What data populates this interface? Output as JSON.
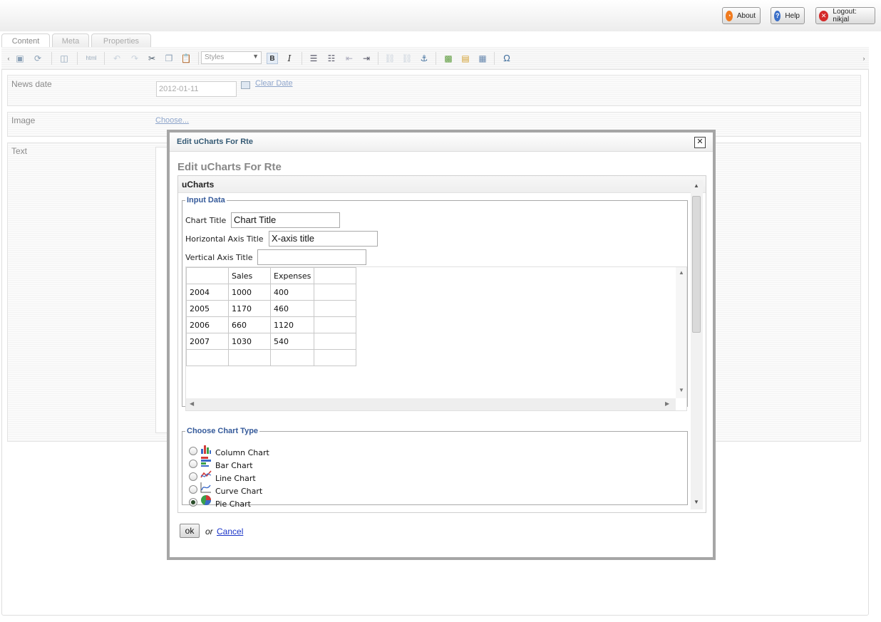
{
  "topbar": {
    "about_label": "About",
    "help_label": "Help",
    "logout_label": "Logout: nikjal"
  },
  "tabs": [
    {
      "label": "Content",
      "active": true
    },
    {
      "label": "Meta",
      "active": false
    },
    {
      "label": "Properties",
      "active": false
    }
  ],
  "toolbar": {
    "styles_value": "Styles",
    "icons": [
      "save-icon",
      "save-publish-icon",
      "preview-icon",
      "html-source-icon",
      "undo-icon",
      "redo-icon",
      "cut-icon",
      "copy-icon",
      "paste-icon",
      "bold-icon",
      "italic-icon",
      "bullet-list-icon",
      "numbered-list-icon",
      "outdent-icon",
      "indent-icon",
      "link-icon",
      "unlink-icon",
      "anchor-icon",
      "image-icon",
      "macro-icon",
      "table-icon",
      "special-char-icon"
    ]
  },
  "form": {
    "news_date_label": "News date",
    "news_date_value": "2012-01-11",
    "clear_date_label": "Clear Date",
    "image_label": "Image",
    "choose_label": "Choose...",
    "text_label": "Text"
  },
  "modal": {
    "title": "Edit uCharts For Rte",
    "heading": "Edit uCharts For Rte",
    "pane_title": "uCharts",
    "input_data_legend": "Input Data",
    "chart_title_label": "Chart Title",
    "chart_title_value": "Chart Title",
    "h_axis_label": "Horizontal Axis Title",
    "h_axis_value": "X-axis title",
    "v_axis_label": "Vertical Axis Title",
    "v_axis_value": "",
    "grid": [
      [
        "",
        "Sales",
        "Expenses",
        ""
      ],
      [
        "2004",
        "1000",
        "400",
        ""
      ],
      [
        "2005",
        "1170",
        "460",
        ""
      ],
      [
        "2006",
        "660",
        "1120",
        ""
      ],
      [
        "2007",
        "1030",
        "540",
        ""
      ],
      [
        "",
        "",
        "",
        ""
      ]
    ],
    "chart_type_legend": "Choose Chart Type",
    "chart_types": [
      {
        "label": "Column Chart",
        "icon": "column-chart-icon",
        "selected": false
      },
      {
        "label": "Bar Chart",
        "icon": "bar-chart-icon",
        "selected": false
      },
      {
        "label": "Line Chart",
        "icon": "line-chart-icon",
        "selected": false
      },
      {
        "label": "Curve Chart",
        "icon": "curve-chart-icon",
        "selected": false
      },
      {
        "label": "Pie Chart",
        "icon": "pie-chart-icon",
        "selected": true
      }
    ],
    "ok_label": "ok",
    "or_text": "or",
    "cancel_label": "Cancel"
  },
  "colors": {
    "about_icon": "#f07a1e",
    "help_icon": "#3b6fc8",
    "logout_icon": "#d42a2a",
    "legend_text": "#355a9a",
    "cancel_link": "#1a34c8"
  }
}
